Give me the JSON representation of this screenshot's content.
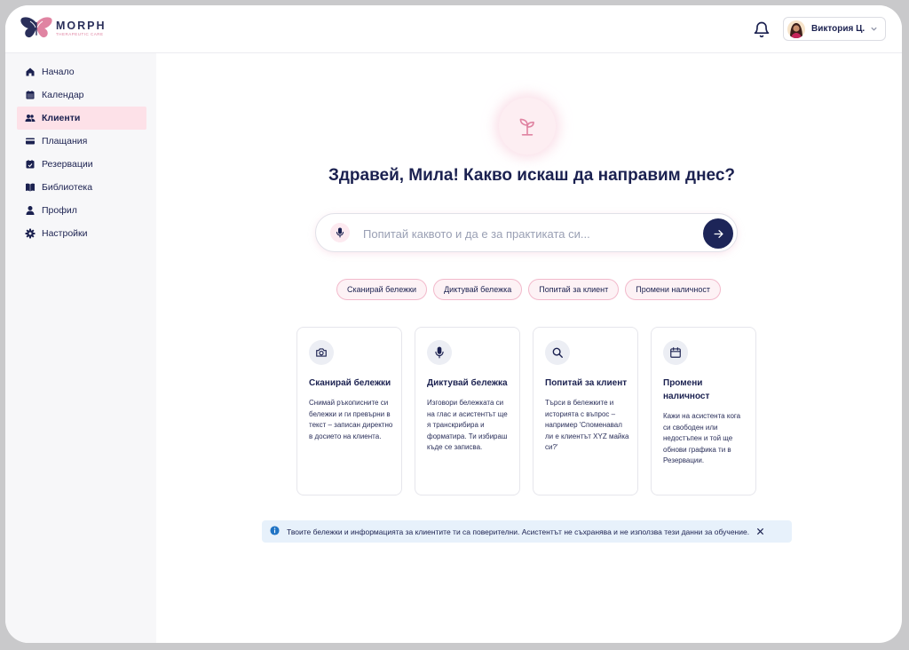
{
  "brand": {
    "name": "MORPH",
    "subtitle": "THERAPEUTIC CARE",
    "accent": "#e084a2",
    "navy": "#1b2150"
  },
  "header": {
    "notifications_icon": "bell-icon",
    "user_name": "Виктория Ц.",
    "user_menu_icon": "chevron-down-icon"
  },
  "sidebar": {
    "items": [
      {
        "label": "Начало",
        "icon": "home-icon",
        "active": false
      },
      {
        "label": "Календар",
        "icon": "calendar-icon",
        "active": false
      },
      {
        "label": "Клиенти",
        "icon": "users-icon",
        "active": true
      },
      {
        "label": "Плащания",
        "icon": "card-icon",
        "active": false
      },
      {
        "label": "Резервации",
        "icon": "calendar-check-icon",
        "active": false
      },
      {
        "label": "Библиотека",
        "icon": "book-icon",
        "active": false
      },
      {
        "label": "Профил",
        "icon": "user-icon",
        "active": false
      },
      {
        "label": "Настройки",
        "icon": "gear-icon",
        "active": false
      }
    ]
  },
  "main": {
    "greeting": "Здравей, Мила! Какво искаш да направим днес?",
    "ask": {
      "placeholder": "Попитай каквото и да е за практиката си...",
      "value": ""
    },
    "chips": [
      "Сканирай бележки",
      "Диктувай бележка",
      "Попитай за клиент",
      "Промени наличност"
    ],
    "cards": [
      {
        "icon": "camera-icon",
        "title": "Сканирай бележки",
        "description": "Снимай ръкописните си бележки и ги превърни в текст – записан директно в досието на клиента."
      },
      {
        "icon": "microphone-icon",
        "title": "Диктувай бележка",
        "description": "Изговори бележката си на глас и асистентът ще я транскрибира и форматира. Ти избираш къде се записва."
      },
      {
        "icon": "search-icon",
        "title": "Попитай за клиент",
        "description": "Търси в бележките и историята с въпрос – например 'Споменавал ли е клиентът XYZ майка си?'"
      },
      {
        "icon": "calendar-icon",
        "title": "Промени наличност",
        "description": "Кажи на асистента кога си свободен или недостъпен и той ще обнови графика ти в Резервации."
      }
    ],
    "notice": "Твоите бележки и информацията за клиентите ти са поверителни. Асистентът не съхранява и не използва тези данни за обучение."
  }
}
